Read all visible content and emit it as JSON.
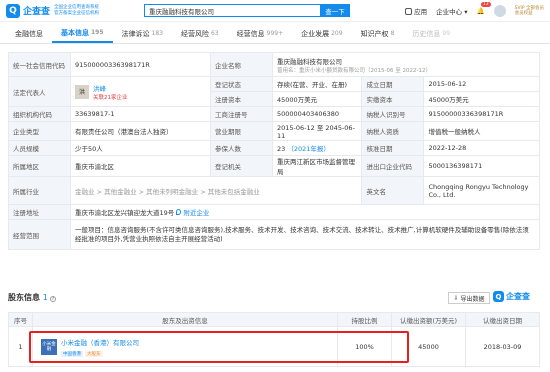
{
  "header": {
    "logo_text": "企查查",
    "slogan": [
      "全国企业信用查询系统",
      "官方备案企业征信机构"
    ],
    "search_value": "重庆融融科技有限公司",
    "search_button": "查一下",
    "nav": [
      "应用",
      "企业中心"
    ],
    "notify_count": "13",
    "vip_label": "SVIP 全部会员",
    "vip_sub": "会员权益"
  },
  "tabs": [
    {
      "label": "金融信息",
      "count": ""
    },
    {
      "label": "基本信息",
      "count": "195"
    },
    {
      "label": "法律诉讼",
      "count": "183"
    },
    {
      "label": "经营风险",
      "count": "63"
    },
    {
      "label": "经营信息",
      "count": "999+"
    },
    {
      "label": "企业发展",
      "count": "209"
    },
    {
      "label": "知识产权",
      "count": "8"
    },
    {
      "label": "历史信息",
      "count": "99"
    }
  ],
  "info": {
    "credit_code_k": "统一社会信用代码",
    "credit_code_v": "91500000336398171R",
    "company_name_k": "企业名称",
    "company_name_v": "重庆融融科技有限公司",
    "former_name": "曾用名：重庆小米小额贷款有限公司（2015-06 至 2022-12）",
    "legal_k": "法定代表人",
    "legal_name": "洪峰",
    "legal_img": "洪",
    "legal_sub": "关联21家企业",
    "status_k": "登记状态",
    "status_v": "存续(在营、开业、在册)",
    "est_k": "成立日期",
    "est_v": "2015-06-12",
    "reg_cap_k": "注册资本",
    "reg_cap_v": "45000万美元",
    "paid_cap_k": "实缴资本",
    "paid_cap_v": "45000万美元",
    "org_code_k": "组织机构代码",
    "org_code_v": "33639817-1",
    "biz_reg_k": "工商注册号",
    "biz_reg_v": "500000403406380",
    "tax_k": "纳税人识别号",
    "tax_v": "91500000336398171R",
    "type_k": "企业类型",
    "type_v": "有限责任公司（港澳台法人独资）",
    "term_k": "营业期限",
    "term_v": "2015-06-12 至 2045-06-11",
    "taxpayer_q_k": "纳税人资质",
    "taxpayer_q_v": "增值税一般纳税人",
    "scale_k": "人员规模",
    "scale_v": "少于50人",
    "insured_k": "参保人数",
    "insured_v": "23",
    "insured_year": "（2021年报）",
    "approve_k": "核准日期",
    "approve_v": "2022-12-28",
    "region_k": "所属地区",
    "region_v": "重庆市渝北区",
    "authority_k": "登记机关",
    "authority_v": "重庆两江新区市场监督管理局",
    "import_k": "进出口企业代码",
    "import_v": "5000136398171",
    "industry_k": "所属行业",
    "industry_v": "金融业 > 其他金融业 > 其他未列明金融业 > 其他未包括金融业",
    "english_k": "英文名",
    "english_v": "Chongqing Rongyu Technology Co., Ltd.",
    "address_k": "注册地址",
    "address_v": "重庆市渝北区龙兴镇迎龙大道19号",
    "address_link": "附近企业",
    "scope_k": "经营范围",
    "scope_v": "一般项目：信息咨询服务(不含许可类信息咨询服务),技术服务、技术开发、技术咨询、技术交流、技术转让、技术推广,计算机软硬件及辅助设备零售(除依法须经批准的项目外,凭营业执照依法自主开展经营活动)"
  },
  "shareholders": {
    "title": "股东信息",
    "count": "1",
    "export": "导出数据",
    "brand": "企查查",
    "headers": [
      "序号",
      "股东及出资信息",
      "持股比例",
      "认缴出资额(万美元)",
      "认缴出资日期"
    ],
    "rows": [
      {
        "idx": "1",
        "logo": "小米金融",
        "name": "小米金融（香港）有限公司",
        "tags": [
          "中国香港",
          "大股东"
        ],
        "ratio": "100%",
        "amount": "45000",
        "date": "2018-03-09"
      }
    ]
  }
}
